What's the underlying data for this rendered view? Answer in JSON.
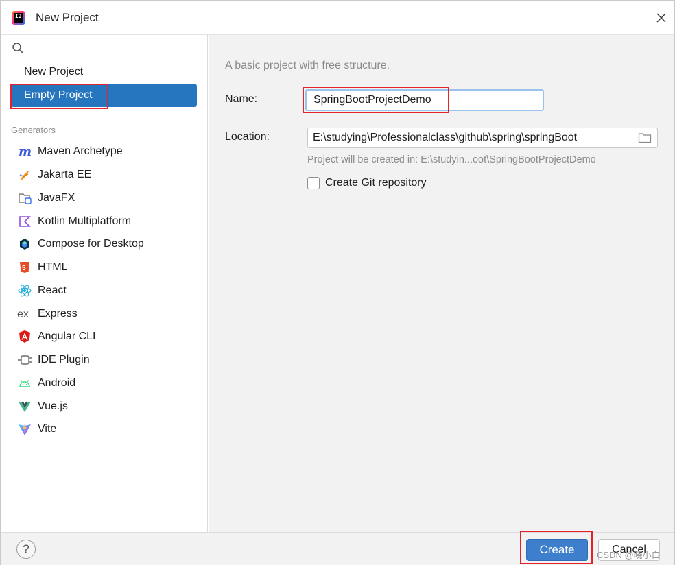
{
  "window": {
    "title": "New Project"
  },
  "sidebar": {
    "search_value": "",
    "project_types": [
      {
        "label": "New Project",
        "selected": false
      },
      {
        "label": "Empty Project",
        "selected": true
      }
    ],
    "generators_label": "Generators",
    "generators": [
      {
        "label": "Maven Archetype",
        "icon": "maven-icon"
      },
      {
        "label": "Jakarta EE",
        "icon": "jakarta-ee-icon"
      },
      {
        "label": "JavaFX",
        "icon": "javafx-icon"
      },
      {
        "label": "Kotlin Multiplatform",
        "icon": "kotlin-icon"
      },
      {
        "label": "Compose for Desktop",
        "icon": "compose-icon"
      },
      {
        "label": "HTML",
        "icon": "html5-icon"
      },
      {
        "label": "React",
        "icon": "react-icon"
      },
      {
        "label": "Express",
        "icon": "express-icon"
      },
      {
        "label": "Angular CLI",
        "icon": "angular-icon"
      },
      {
        "label": "IDE Plugin",
        "icon": "plugin-icon"
      },
      {
        "label": "Android",
        "icon": "android-icon"
      },
      {
        "label": "Vue.js",
        "icon": "vue-icon"
      },
      {
        "label": "Vite",
        "icon": "vite-icon"
      }
    ]
  },
  "form": {
    "description": "A basic project with free structure.",
    "name_label": "Name:",
    "name_value": "SpringBootProjectDemo",
    "location_label": "Location:",
    "location_value": "E:\\studying\\Professionalclass\\github\\spring\\springBoot",
    "location_hint": "Project will be created in: E:\\studyin...oot\\SpringBootProjectDemo",
    "git_label": "Create Git repository",
    "git_checked": false
  },
  "footer": {
    "help_label": "?",
    "create_label": "Create",
    "cancel_label": "Cancel",
    "watermark": "CSDN @晓小白"
  },
  "colors": {
    "selection": "#2675bf",
    "highlight_box": "#e5222a",
    "primary_button": "#3d7fcc",
    "panel_background": "#f2f2f2"
  }
}
